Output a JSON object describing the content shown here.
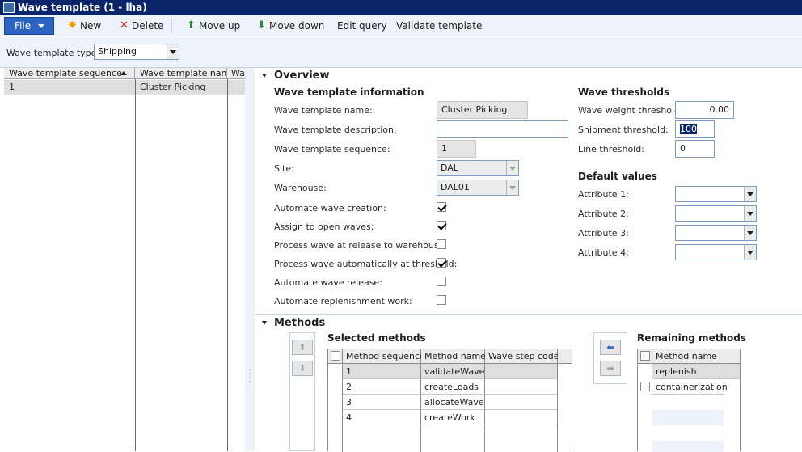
{
  "window": {
    "title": "Wave template (1 - lha)"
  },
  "toolbar": {
    "file_label": "File",
    "new_label": "New",
    "delete_label": "Delete",
    "move_up_label": "Move up",
    "move_down_label": "Move down",
    "edit_query_label": "Edit query",
    "validate_template_label": "Validate template"
  },
  "filter": {
    "type_label": "Wave template type:",
    "type_value": "Shipping"
  },
  "list": {
    "headers": [
      "Wave template sequence",
      "Wave template name",
      "Wa"
    ],
    "rows": [
      {
        "sequence": "1",
        "name": "Cluster Picking"
      }
    ]
  },
  "overview": {
    "title": "Overview",
    "info_title": "Wave template information",
    "fields": {
      "name_label": "Wave template name:",
      "name_value": "Cluster Picking",
      "description_label": "Wave template description:",
      "description_value": "",
      "sequence_label": "Wave template sequence:",
      "sequence_value": "1",
      "site_label": "Site:",
      "site_value": "DAL",
      "warehouse_label": "Warehouse:",
      "warehouse_value": "DAL01",
      "auto_creation_label": "Automate wave creation:",
      "auto_creation": true,
      "assign_open_label": "Assign to open waves:",
      "assign_open": true,
      "process_release_label": "Process wave at release to warehouse:",
      "process_release": false,
      "process_threshold_label": "Process wave automatically at threshold:",
      "process_threshold": true,
      "auto_release_label": "Automate wave release:",
      "auto_release": false,
      "auto_replen_label": "Automate replenishment work:",
      "auto_replen": false
    },
    "thresholds_title": "Wave thresholds",
    "thresholds": {
      "weight_label": "Wave weight threshold:",
      "weight_value": "0.00",
      "shipment_label": "Shipment threshold:",
      "shipment_value": "100",
      "line_label": "Line threshold:",
      "line_value": "0"
    },
    "defaults_title": "Default values",
    "defaults": {
      "attr1_label": "Attribute 1:",
      "attr1_value": "",
      "attr2_label": "Attribute 2:",
      "attr2_value": "",
      "attr3_label": "Attribute 3:",
      "attr3_value": "",
      "attr4_label": "Attribute 4:",
      "attr4_value": ""
    }
  },
  "methods": {
    "title": "Methods",
    "selected_title": "Selected methods",
    "selected_headers": [
      "Method sequence",
      "Method name",
      "Wave step code"
    ],
    "selected_rows": [
      {
        "seq": "1",
        "name": "validateWave",
        "code": ""
      },
      {
        "seq": "2",
        "name": "createLoads",
        "code": ""
      },
      {
        "seq": "3",
        "name": "allocateWave",
        "code": ""
      },
      {
        "seq": "4",
        "name": "createWork",
        "code": ""
      }
    ],
    "remaining_title": "Remaining methods",
    "remaining_header": "Method name",
    "remaining_rows": [
      {
        "name": "replenish"
      },
      {
        "name": "containerization"
      }
    ]
  },
  "icons": {
    "new": "sparkle-icon",
    "delete": "x-icon",
    "move_up": "arrow-up-icon",
    "move_down": "arrow-down-icon",
    "colors": {
      "titlebar": "#0a246a",
      "file": "#2a63c2",
      "pane": "#eef3fb"
    }
  }
}
